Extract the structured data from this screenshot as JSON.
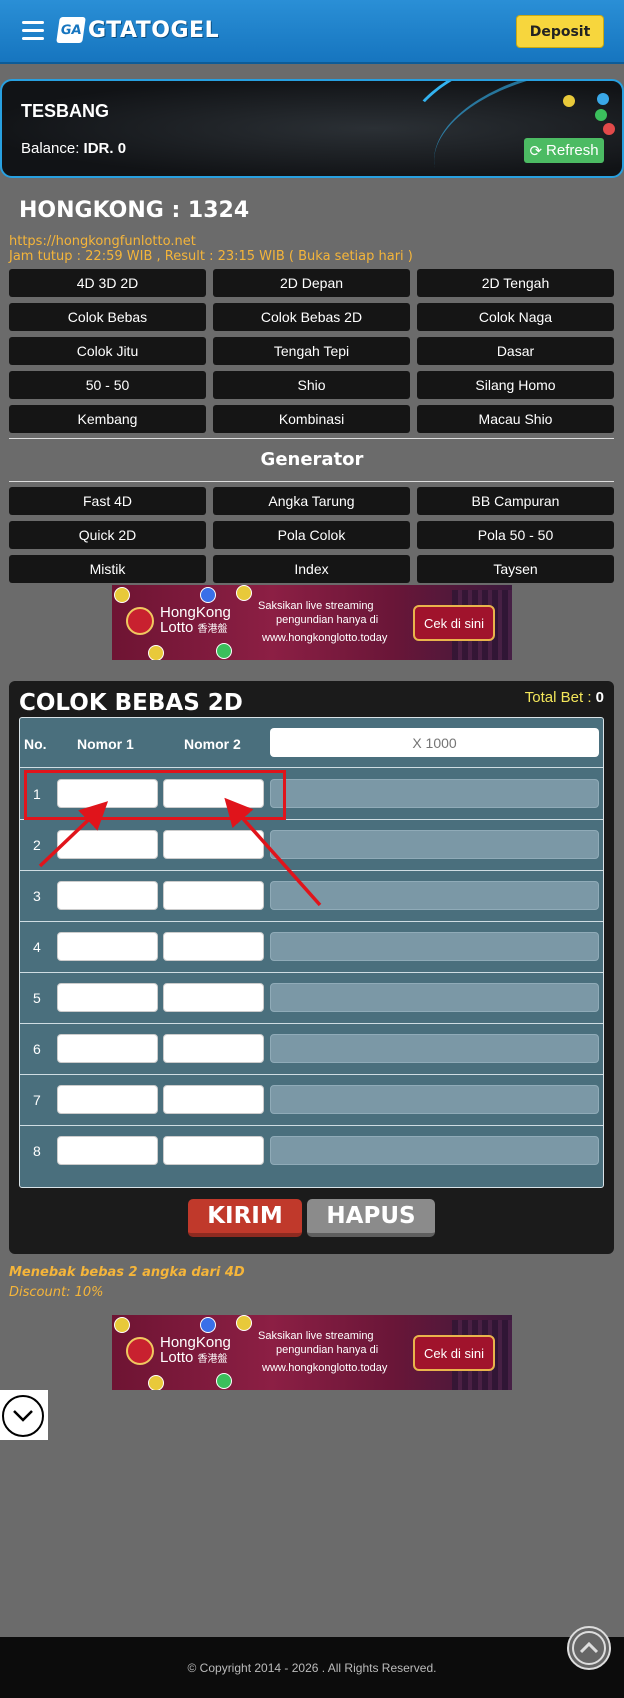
{
  "header": {
    "logo_mark": "GA",
    "logo_text": "GTATOGEL",
    "deposit_label": "Deposit"
  },
  "account": {
    "username": "TESBANG",
    "balance_label": "Balance:",
    "balance_value": "IDR. 0",
    "refresh_label": "Refresh"
  },
  "market": {
    "title": "HONGKONG : 1324",
    "url": "https://hongkongfunlotto.net",
    "schedule": "Jam tutup : 22:59 WIB , Result : 23:15 WIB ( Buka setiap hari )"
  },
  "game_types": [
    "4D 3D 2D",
    "2D Depan",
    "2D Tengah",
    "Colok Bebas",
    "Colok Bebas 2D",
    "Colok Naga",
    "Colok Jitu",
    "Tengah Tepi",
    "Dasar",
    "50 - 50",
    "Shio",
    "Silang Homo",
    "Kembang",
    "Kombinasi",
    "Macau Shio"
  ],
  "generator": {
    "title": "Generator",
    "items": [
      "Fast 4D",
      "Angka Tarung",
      "BB Campuran",
      "Quick 2D",
      "Pola Colok",
      "Pola 50 - 50",
      "Mistik",
      "Index",
      "Taysen"
    ]
  },
  "banner": {
    "brand_line1": "HongKong",
    "brand_line2": "Lotto",
    "brand_cn": "香港盤",
    "line1": "Saksikan live streaming",
    "line2": "pengundian hanya di",
    "url": "www.hongkonglotto.today",
    "cta": "Cek di sini"
  },
  "bet_panel": {
    "title": "COLOK BEBAS 2D",
    "total_bet_label": "Total Bet :",
    "total_bet_value": "0",
    "col_no": "No.",
    "col_nomor1": "Nomor 1",
    "col_nomor2": "Nomor 2",
    "multiplier_placeholder": "X 1000",
    "rows": [
      "1",
      "2",
      "3",
      "4",
      "5",
      "6",
      "7",
      "8"
    ],
    "submit_label": "KIRIM",
    "clear_label": "HAPUS"
  },
  "description": {
    "line1": "Menebak bebas 2 angka dari 4D",
    "line2": "Discount: 10%"
  },
  "footer": {
    "copyright": "© Copyright 2014 - 2026 . All Rights Reserved."
  },
  "colors": {
    "header_blue": "#1675bf",
    "deposit_yellow": "#f7d63d",
    "accent_orange": "#f5b53a",
    "kirim_red": "#c0392b",
    "annotation_red": "#e0141b"
  }
}
